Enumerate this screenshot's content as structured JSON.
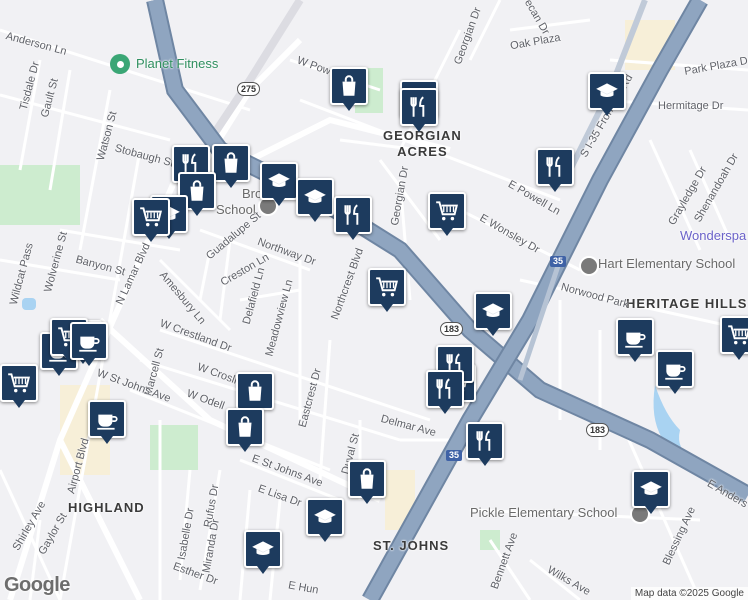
{
  "map": {
    "area_labels": [
      {
        "id": "georgian-acres",
        "text": "GEORGIAN\nACRES"
      },
      {
        "id": "heritage-hills",
        "text": "HERITAGE HILLS"
      },
      {
        "id": "highland",
        "text": "HIGHLAND"
      },
      {
        "id": "st-johns",
        "text": "ST. JOHNS"
      }
    ],
    "poi_labels": [
      {
        "id": "planet-fitness",
        "text": "Planet Fitness"
      },
      {
        "id": "brown-school-a",
        "text": "Brown"
      },
      {
        "id": "brown-school-b",
        "text": "School"
      },
      {
        "id": "hart-elementary",
        "text": "Hart Elementary School"
      },
      {
        "id": "pickle-elementary",
        "text": "Pickle Elementary School"
      },
      {
        "id": "wonderspaces",
        "text": "Wonderspa"
      }
    ],
    "street_labels": [
      "Anderson Ln",
      "Tisdale Dr",
      "Gault St",
      "Watson St",
      "Stobaugh St",
      "Wolverine St",
      "Banyon St",
      "Wildcat Pass",
      "N Lamar Blvd",
      "Guadalupe St",
      "Creston Ln",
      "Northway Dr",
      "Delafield Ln",
      "Amesbury Ln",
      "Meadowview Ln",
      "Northcrest Blvd",
      "W Crestland Dr",
      "Marcell St",
      "W St Johns Ave",
      "W Crosling",
      "W Odell",
      "Eastcrest Dr",
      "E St Johns Ave",
      "E Lisa Dr",
      "Airport Blvd",
      "Shirley Ave",
      "Gaylor St",
      "Isabelle Dr",
      "Rufus Dr",
      "Miranda Dr",
      "Esther Dr",
      "Georgian Dr",
      "Oak Plaza",
      "Pecan Dr",
      "W Powell",
      "E Powell Ln",
      "E Wonsley Dr",
      "Norwood Park",
      "Delmar Ave",
      "Duval St",
      "S I-35 Frontage Rd",
      "Park Plaza Dr",
      "Hermitage Dr",
      "Grayledge Dr",
      "Shenandoah Dr",
      "Bennett Ave",
      "Wilks Ave",
      "Blessing Ave",
      "E Anders",
      "Georgian Dr",
      "Oak Plaza",
      "E Hun"
    ],
    "route_shields": [
      {
        "id": "275",
        "text": "275",
        "type": "state"
      },
      {
        "id": "183a",
        "text": "183",
        "type": "us"
      },
      {
        "id": "183b",
        "text": "183",
        "type": "us"
      },
      {
        "id": "i35a",
        "text": "35",
        "type": "interstate"
      },
      {
        "id": "i35b",
        "text": "35",
        "type": "interstate"
      }
    ],
    "markers": [
      {
        "type": "shopping-bag"
      },
      {
        "type": "restaurant"
      },
      {
        "type": "school"
      },
      {
        "type": "restaurant"
      },
      {
        "type": "shopping-bag"
      },
      {
        "type": "restaurant"
      },
      {
        "type": "school"
      },
      {
        "type": "school"
      },
      {
        "type": "shopping-bag"
      },
      {
        "type": "restaurant"
      },
      {
        "type": "restaurant"
      },
      {
        "type": "grocery-cart"
      },
      {
        "type": "grocery-cart"
      },
      {
        "type": "school"
      },
      {
        "type": "grocery-cart"
      },
      {
        "type": "cafe"
      },
      {
        "type": "cafe"
      },
      {
        "type": "grocery-cart"
      },
      {
        "type": "grocery-cart"
      },
      {
        "type": "cafe"
      },
      {
        "type": "shopping-bag"
      },
      {
        "type": "shopping-bag"
      },
      {
        "type": "restaurant"
      },
      {
        "type": "restaurant"
      },
      {
        "type": "restaurant"
      },
      {
        "type": "school"
      },
      {
        "type": "cafe"
      },
      {
        "type": "cafe"
      },
      {
        "type": "grocery-cart"
      },
      {
        "type": "shopping-bag"
      },
      {
        "type": "school"
      },
      {
        "type": "school"
      },
      {
        "type": "school"
      },
      {
        "type": "grocery-cart"
      },
      {
        "type": "cafe"
      }
    ],
    "attribution": {
      "logo": "Google",
      "data": "Map data ©2025 Google"
    },
    "colors": {
      "background": "#f1f1f4",
      "freeway": "#8fa5c0",
      "freeway_edge": "#6f86a3",
      "park": "#cdeccf",
      "marker": "#1d3b5e"
    }
  }
}
